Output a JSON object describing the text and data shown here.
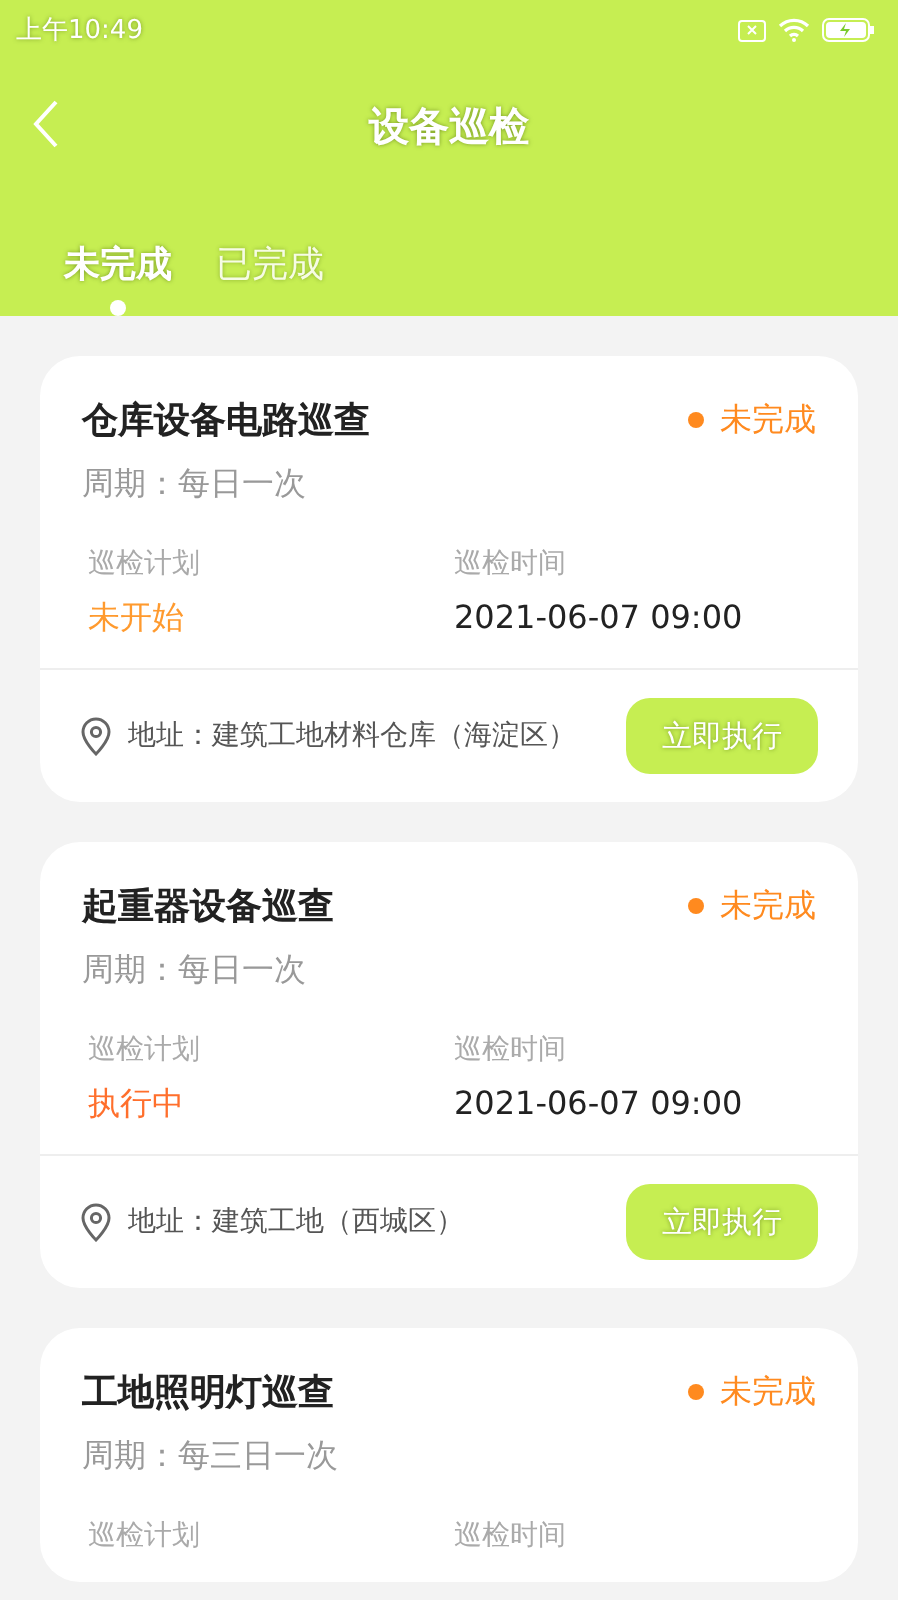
{
  "status_bar": {
    "time": "上午10:49"
  },
  "header": {
    "title": "设备巡检"
  },
  "tabs": [
    {
      "label": "未完成",
      "selected": true
    },
    {
      "label": "已完成",
      "selected": false
    }
  ],
  "tasks": [
    {
      "title": "仓库设备电路巡查",
      "status": "未完成",
      "period": "周期：每日一次",
      "plan_label": "巡检计划",
      "plan": {
        "text": "未开始",
        "kind": "not_started"
      },
      "time_label": "巡检时间",
      "time": "2021-06-07 09:00",
      "address": "地址：建筑工地材料仓库（海淀区）",
      "action": "立即执行"
    },
    {
      "title": "起重器设备巡查",
      "status": "未完成",
      "period": "周期：每日一次",
      "plan_label": "巡检计划",
      "plan": {
        "text": "执行中",
        "kind": "in_progress"
      },
      "time_label": "巡检时间",
      "time": "2021-06-07 09:00",
      "address": "地址：建筑工地（西城区）",
      "action": "立即执行"
    },
    {
      "title": "工地照明灯巡查",
      "status": "未完成",
      "period": "周期：每三日一次",
      "plan_label": "巡检计划",
      "time_label": "巡检时间"
    }
  ]
}
